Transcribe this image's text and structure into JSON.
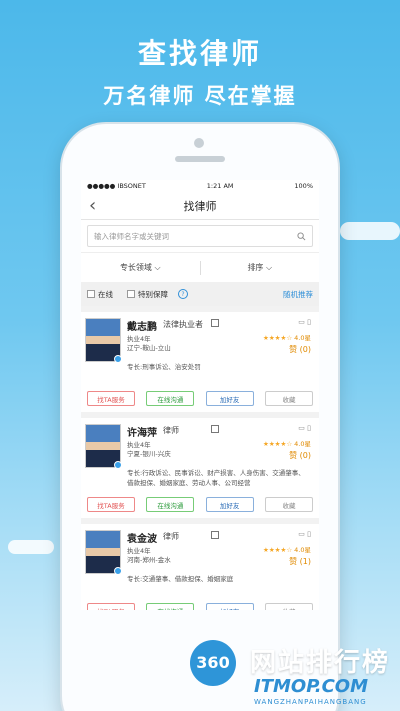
{
  "promo": {
    "headline": "查找律师",
    "subline": "万名律师  尽在掌握"
  },
  "status_bar": {
    "carrier": "●●●●● IBSONET",
    "time": "1:21 AM",
    "battery": "100%"
  },
  "nav": {
    "back": "‹",
    "title": "找律师"
  },
  "search": {
    "placeholder": "输入律师名字或关键词"
  },
  "filters": {
    "field": "专长领域",
    "sort": "排序"
  },
  "toolbar": {
    "online": "在线",
    "special": "特别保障",
    "help": "?",
    "random": "随机推荐"
  },
  "lawyers": [
    {
      "name": "戴志鹏",
      "role": "法律执业者",
      "years": "执业4年",
      "location": "辽宁-鞍山-立山",
      "rating": "4.0星",
      "likes": "赞 (0)",
      "specialty": "专长:刑事诉讼、治安处罚"
    },
    {
      "name": "许海萍",
      "role": "律师",
      "years": "执业4年",
      "location": "宁夏-银川-兴庆",
      "rating": "4.0星",
      "likes": "赞 (0)",
      "specialty": "专长:行政诉讼、民事诉讼、财产损害、人身伤害、交通肇事、借款担保、婚姻家庭、劳动人事、公司经营"
    },
    {
      "name": "袁金波",
      "role": "律师",
      "years": "执业4年",
      "location": "河南-郑州-金水",
      "rating": "4.0星",
      "likes": "赞 (1)",
      "specialty": "专长:交通肇事、借款担保、婚姻家庭"
    }
  ],
  "actions": {
    "find": "找TA服务",
    "chat": "在线沟通",
    "friend": "加好友",
    "fav": "收藏"
  },
  "watermark": {
    "logo": "360",
    "title": "网站排行榜",
    "domain": "ITMOP.COM",
    "sub": "WANGZHANPAIHANGBANG"
  }
}
